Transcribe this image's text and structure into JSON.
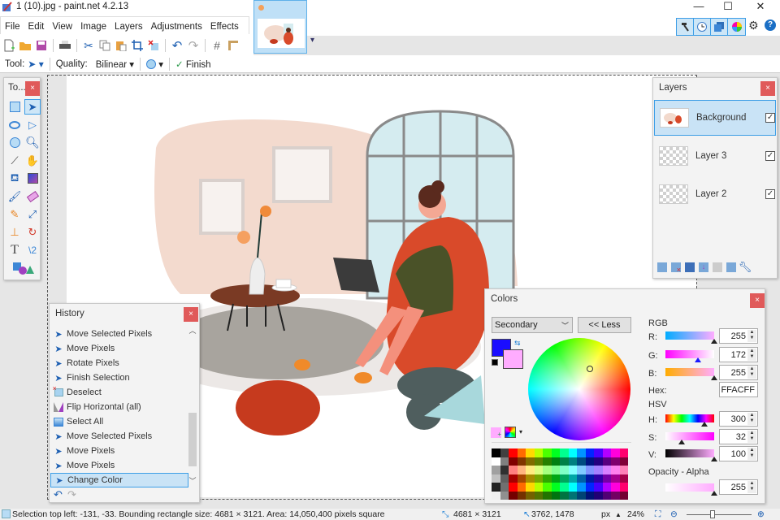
{
  "window": {
    "title": "1 (10).jpg - paint.net 4.2.13",
    "minimize": "—",
    "maximize": "☐",
    "close": "✕"
  },
  "menu": [
    "File",
    "Edit",
    "View",
    "Image",
    "Layers",
    "Adjustments",
    "Effects"
  ],
  "toolbar": {
    "tool_label": "Tool:",
    "quality_label": "Quality:",
    "quality_value": "Bilinear",
    "finish_label": "Finish"
  },
  "tools_panel": {
    "title": "To...",
    "close": "×"
  },
  "layers_panel": {
    "title": "Layers",
    "close": "×",
    "layers": [
      {
        "name": "Background",
        "visible": true,
        "selected": true
      },
      {
        "name": "Layer 3",
        "visible": true,
        "selected": false
      },
      {
        "name": "Layer 2",
        "visible": true,
        "selected": false
      }
    ],
    "check": "✓"
  },
  "history_panel": {
    "title": "History",
    "close": "×",
    "items": [
      {
        "label": "Move Selected Pixels",
        "icon": "move-selection-icon"
      },
      {
        "label": "Move Pixels",
        "icon": "move-selection-icon"
      },
      {
        "label": "Rotate Pixels",
        "icon": "move-selection-icon"
      },
      {
        "label": "Finish Selection",
        "icon": "move-selection-icon"
      },
      {
        "label": "Deselect",
        "icon": "deselect-icon"
      },
      {
        "label": "Flip Horizontal (all)",
        "icon": "flip-horizontal-icon"
      },
      {
        "label": "Select All",
        "icon": "select-all-icon"
      },
      {
        "label": "Move Selected Pixels",
        "icon": "move-selection-icon"
      },
      {
        "label": "Move Pixels",
        "icon": "move-selection-icon"
      },
      {
        "label": "Move Pixels",
        "icon": "move-selection-icon"
      },
      {
        "label": "Change Color",
        "icon": "move-selection-icon",
        "selected": true
      }
    ]
  },
  "colors_panel": {
    "title": "Colors",
    "mode": "Secondary",
    "less_button": "<< Less",
    "primary_color": "#1a0dff",
    "secondary_color": "#ffacff",
    "rgb_label": "RGB",
    "r_label": "R:",
    "r": "255",
    "g_label": "G:",
    "g": "172",
    "b_label": "B:",
    "b": "255",
    "hex_label": "Hex:",
    "hex": "FFACFF",
    "hsv_label": "HSV",
    "h_label": "H:",
    "h": "300",
    "s_label": "S:",
    "s": "32",
    "v_label": "V:",
    "v": "100",
    "alpha_label": "Opacity - Alpha",
    "alpha": "255"
  },
  "status": {
    "selection_info": "Selection top left: -131, -33. Bounding rectangle size: 4681 × 3121. Area: 14,050,400 pixels square",
    "image_size": "4681 × 3121",
    "cursor_pos": "3762, 1478",
    "units": "px",
    "zoom": "24%"
  }
}
